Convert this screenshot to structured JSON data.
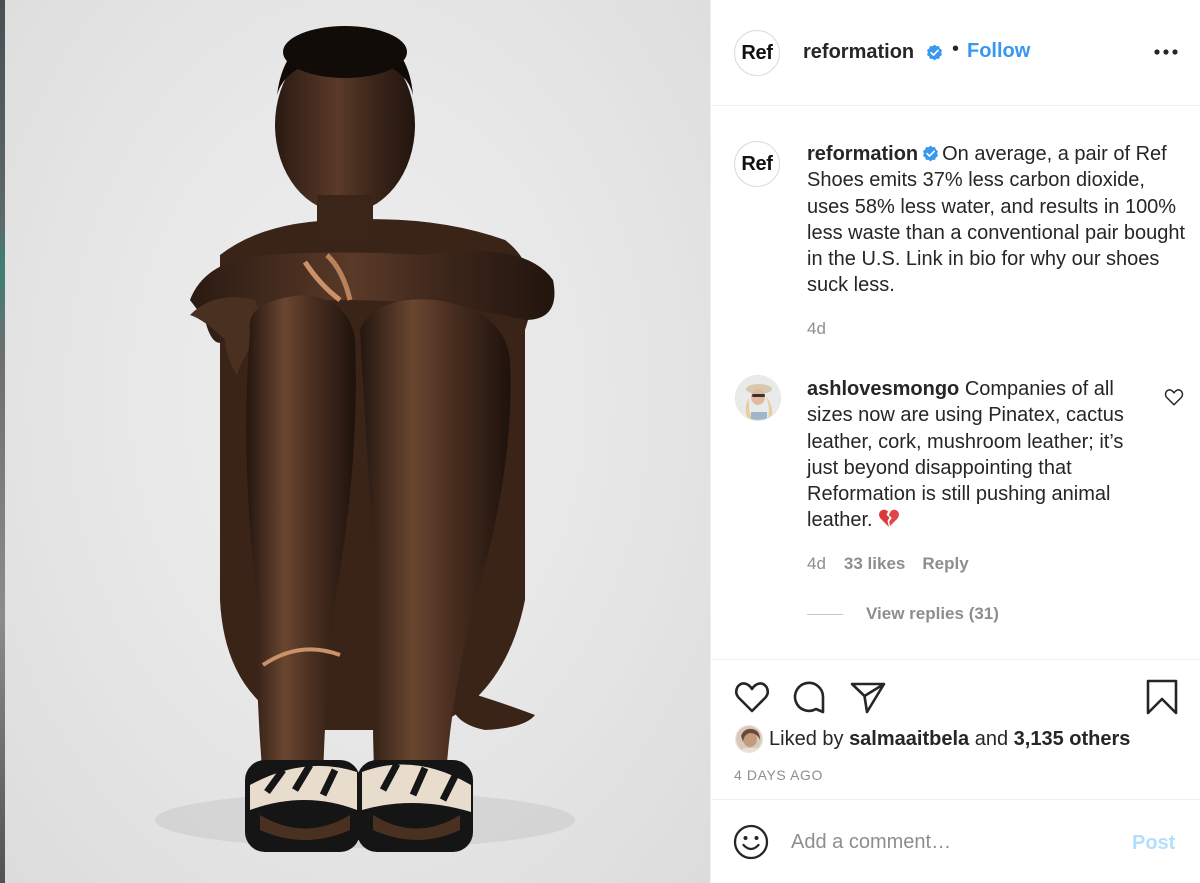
{
  "post": {
    "image_description": "photo",
    "header": {
      "avatar_text": "Ref",
      "username": "reformation",
      "separator": "•",
      "follow_label": "Follow"
    },
    "caption": {
      "avatar_text": "Ref",
      "username": "reformation",
      "text": "On average, a pair of Ref Shoes emits 37% less carbon dioxide, uses 58% less water, and results in 100% less waste than a conventional pair bought in the U.S. Link in bio for why our shoes suck less.",
      "age": "4d"
    },
    "comments": [
      {
        "username": "ashlovesmongo",
        "text": "Companies of all sizes now are using Pinatex, cactus leather, cork, mushroom leather; it’s just beyond disappointing that Reformation is still pushing animal leather.",
        "emoji": "broken-heart",
        "age": "4d",
        "likes": "33 likes",
        "reply_label": "Reply",
        "view_replies": "View replies (31)"
      }
    ],
    "likes": {
      "prefix": "Liked by",
      "user": "salmaaitbela",
      "joiner": "and",
      "others": "3,135 others"
    },
    "timestamp": "4 DAYS AGO",
    "add_comment": {
      "placeholder": "Add a comment…",
      "post_label": "Post"
    }
  },
  "icons": {
    "more": "more-options-icon",
    "verified": "verified-badge-icon",
    "like": "heart-icon",
    "comment": "comment-bubble-icon",
    "share": "paper-plane-icon",
    "save": "bookmark-icon",
    "emoji": "smiley-icon"
  },
  "colors": {
    "link_blue": "#3897f0",
    "post_disabled": "#b2dffc",
    "muted": "#8e8e8e",
    "text": "#262626"
  }
}
